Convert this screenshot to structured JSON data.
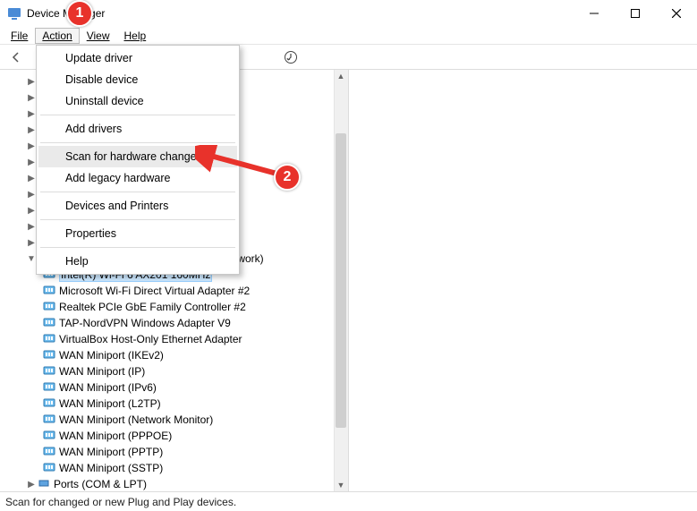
{
  "window": {
    "title": "Device Manager",
    "minimize_aria": "Minimize",
    "maximize_aria": "Maximize",
    "close_aria": "Close"
  },
  "menubar": {
    "file": "File",
    "action": "Action",
    "view": "View",
    "help": "Help"
  },
  "action_menu": {
    "update_driver": "Update driver",
    "disable_device": "Disable device",
    "uninstall_device": "Uninstall device",
    "add_drivers": "Add drivers",
    "scan_hardware": "Scan for hardware changes",
    "add_legacy": "Add legacy hardware",
    "devices_printers": "Devices and Printers",
    "properties": "Properties",
    "help": "Help"
  },
  "tree": {
    "network_adapters_suffix": "twork)",
    "items": [
      "Intel(R) Wi-Fi 6 AX201 160MHz",
      "Microsoft Wi-Fi Direct Virtual Adapter #2",
      "Realtek PCIe GbE Family Controller #2",
      "TAP-NordVPN Windows Adapter V9",
      "VirtualBox Host-Only Ethernet Adapter",
      "WAN Miniport (IKEv2)",
      "WAN Miniport (IP)",
      "WAN Miniport (IPv6)",
      "WAN Miniport (L2TP)",
      "WAN Miniport (Network Monitor)",
      "WAN Miniport (PPPOE)",
      "WAN Miniport (PPTP)",
      "WAN Miniport (SSTP)"
    ],
    "ports": "Ports (COM & LPT)"
  },
  "statusbar": {
    "text": "Scan for changed or new Plug and Play devices."
  },
  "annotations": {
    "callout1": "1",
    "callout2": "2"
  }
}
